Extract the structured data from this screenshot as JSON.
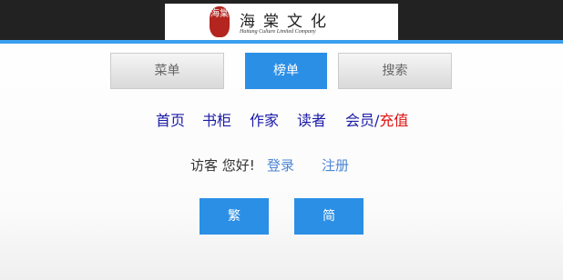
{
  "header": {
    "logo": {
      "seal_text": "海棠",
      "title": "海棠文化",
      "subtitle": "Haitang Culture Limited Company"
    }
  },
  "menu": {
    "menu_label": "菜单",
    "rank_label": "榜单",
    "search_label": "搜索"
  },
  "nav": {
    "home": "首页",
    "bookshelf": "书柜",
    "author": "作家",
    "reader": "读者",
    "member": "会员",
    "separator": "/",
    "recharge": "充值"
  },
  "account": {
    "greeting": "访客 您好!",
    "login": "登录",
    "register": "注册"
  },
  "script_switch": {
    "traditional": "繁",
    "simplified": "简"
  },
  "colors": {
    "accent_blue": "#2b8fe6",
    "header_bg": "#222222",
    "header_border": "#3aa0ee",
    "nav_link": "#1a1aa8",
    "recharge_red": "#e01010",
    "account_link": "#4d86d6"
  }
}
